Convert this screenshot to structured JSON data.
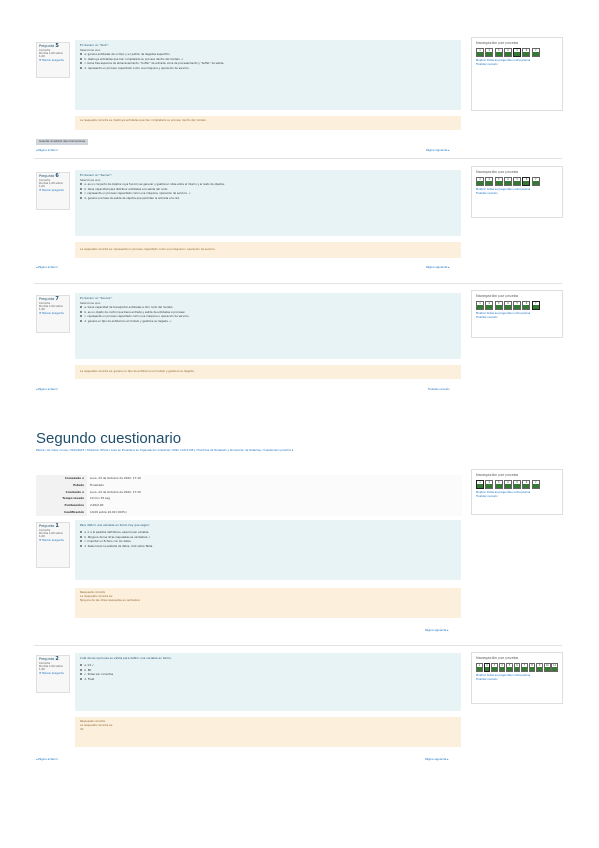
{
  "block1": {
    "info": {
      "label": "Pregunta",
      "num": "5",
      "state": "Correcta",
      "mark": "Puntúa 1,00 sobre 1,00",
      "flag": "Marcar pregunta"
    },
    "question": "En Sensor un \"Sink\":",
    "select": "Seleccione una:",
    "options": [
      {
        "letter": "a.",
        "text": "genera entidades de un tipo y un patrón de llegadas específico",
        "checked": false,
        "correct": false
      },
      {
        "letter": "b.",
        "text": "destruye entidades que han completado su proceso dentro del modelo.",
        "checked": true,
        "correct": true
      },
      {
        "letter": "c.",
        "text": "tiene tres espacios de almacenamiento: \"buffer\" de entrada, zona de procesamiento y \"buffer\" de salida.",
        "checked": false,
        "correct": false
      },
      {
        "letter": "d.",
        "text": "representa un proceso capacitado como una máquina y operación de servicio.",
        "checked": false,
        "correct": false
      }
    ],
    "feedback": "La respuesta correcta es: destruye entidades que han completado su proceso dentro del modelo.",
    "button": "Guardar el estado das marcaciones",
    "prev": "◂ Página anterior",
    "next": "Página siguiente ▸",
    "nav": {
      "title": "Navegación por prueba",
      "cells": [
        "1",
        "2",
        "3",
        "4",
        "5",
        "6",
        "7"
      ],
      "current": 4,
      "link1": "Mostrar todas as preguntas nunha páxina",
      "link2": "Finalizar revisión"
    }
  },
  "block2": {
    "info": {
      "label": "Pregunta",
      "num": "6",
      "state": "Correcta",
      "mark": "Puntúa 1,00 sobre 1,00",
      "flag": "Marcar pregunta"
    },
    "question": "En Sensor un \"Server\":",
    "select": "Seleccione una:",
    "options": [
      {
        "letter": "a.",
        "text": "es un conjunto de objetos cuya función es generar y gestionar rutas entre el mismo y el resto de objetos.",
        "checked": false,
        "correct": false
      },
      {
        "letter": "b.",
        "text": "tiene capacidad para distribuir entidades a la salida del nodo.",
        "checked": false,
        "correct": false
      },
      {
        "letter": "c.",
        "text": "representa un proceso capacitado como una máquina, operación de servicio.",
        "checked": true,
        "correct": true
      },
      {
        "letter": "d.",
        "text": "genera una tasa de salida de objetos que permiten la entrada a la red.",
        "checked": false,
        "correct": false
      }
    ],
    "feedback": "La respuesta correcta es: representa un proceso capacitado como una máquina u operación de servicio.",
    "prev": "◂ Página anterior",
    "next": "Página siguiente ▸",
    "nav": {
      "title": "Navegación por prueba",
      "cells": [
        "1",
        "2",
        "3",
        "4",
        "5",
        "6",
        "7"
      ],
      "current": 5,
      "link1": "Mostrar todas as preguntas nunha páxina",
      "link2": "Finalizar revisión"
    }
  },
  "block3": {
    "info": {
      "label": "Pregunta",
      "num": "7",
      "state": "Correcta",
      "mark": "Puntúa 1,00 sobre 1,00",
      "flag": "Marcar pregunta"
    },
    "question": "En Sensor un \"Source\":",
    "select": "Seleccione una:",
    "options": [
      {
        "letter": "a.",
        "text": "tiene capacidad de transportar entidades a otro nodo del modelo.",
        "checked": false,
        "correct": false
      },
      {
        "letter": "b.",
        "text": "es un objeto de control que tiene entrada y salida de entidades a procesar.",
        "checked": false,
        "correct": false
      },
      {
        "letter": "c.",
        "text": "representa un proceso capacitado como una máquina u operación de servicio.",
        "checked": false,
        "correct": false
      },
      {
        "letter": "d.",
        "text": "genera un tipo de entidad en el modelo y gestiona su llegada.",
        "checked": true,
        "correct": true
      }
    ],
    "feedback": "La respuesta correcta es: genera un tipo de entidad en el modelo y gestiona su llegada.",
    "prev": "◂ Página anterior",
    "next": "Finalizar revisión",
    "nav": {
      "title": "Navegación por prueba",
      "cells": [
        "1",
        "2",
        "3",
        "4",
        "5",
        "6",
        "7"
      ],
      "current": 6,
      "link1": "Mostrar todas as preguntas nunha páxina",
      "link2": "Finalizar revisión"
    }
  },
  "page2": {
    "title": "Segundo cuestionario",
    "breadcrumb": "Páxina / Os meus cursos / 2022/2023 / Titulación Oficial / Grao en Enxeñaría en Organización Industrial / 2022 / G2111451 / Prácticas de Modelado y Simulación de Sistemas / Cuestionario práctica 4",
    "summary": [
      {
        "k": "Comezado o",
        "v": "Luns, 24 de Outubro de 2022, 17:10"
      },
      {
        "k": "Estado",
        "v": "Finalizado"
      },
      {
        "k": "Concluído o",
        "v": "Luns, 24 de Outubro de 2022, 17:20"
      },
      {
        "k": "Tempo levado",
        "v": "10 min 35 seg"
      },
      {
        "k": "Puntuacións",
        "v": "2,00/2,00"
      },
      {
        "k": "Cualificación",
        "v": "10,00 sobre 10,00 (100%)"
      }
    ],
    "q1": {
      "info": {
        "label": "Pregunta",
        "num": "1",
        "state": "Correcta",
        "mark": "Puntúa 1,00 sobre 1,00",
        "flag": "Marcar pregunta"
      },
      "question": "Para definir una variable en Simio hay que seguir:",
      "options": [
        {
          "letter": "a.",
          "text": "Ir a la pestaña definitions, seleccionar variable.",
          "checked": false,
          "correct": false
        },
        {
          "letter": "b.",
          "text": "Ninguna de las otras respuestas es verdadera",
          "checked": true,
          "correct": true
        },
        {
          "letter": "c.",
          "text": "Importar un fichero con los datos.",
          "checked": false,
          "correct": false
        },
        {
          "letter": "d.",
          "text": "Seleccionar la pestaña de datos, click sobre Tabla.",
          "checked": false,
          "correct": false
        }
      ],
      "fb_title": "Respuesta correcta",
      "fb_line1": "La respuesta correcta es:",
      "fb_line2": "Ninguna de las otras respuestas es verdadera",
      "next": "Página siguiente ▸"
    },
    "q2": {
      "info": {
        "label": "Pregunta",
        "num": "2",
        "state": "Correcta",
        "mark": "Puntúa 1,00 sobre 1,00",
        "flag": "Marcar pregunta"
      },
      "question": "Cuál de las opciones es válida para definir una variable en Simio:",
      "options": [
        {
          "letter": "a.",
          "text": "Int",
          "checked": true,
          "correct": true
        },
        {
          "letter": "b.",
          "text": "Bit",
          "checked": false,
          "correct": false
        },
        {
          "letter": "c.",
          "text": "Todas son correctas",
          "checked": false,
          "correct": false
        },
        {
          "letter": "d.",
          "text": "Float",
          "checked": false,
          "correct": false
        }
      ],
      "fb_title": "Respuesta correcta",
      "fb_line1": "La respuesta correcta es:",
      "fb_line2": "Int",
      "prev": "◂ Página anterior",
      "next": "Página siguiente ▸"
    },
    "nav1": {
      "title": "Navegación por prueba",
      "cells": [
        "1",
        "2",
        "3",
        "4",
        "5",
        "6",
        "7"
      ],
      "current": 0,
      "link1": "Mostrar todas as preguntas nunha páxina",
      "link2": "Finalizar revisión"
    },
    "nav2": {
      "title": "Navegación por prueba",
      "cells": [
        "1",
        "2",
        "3",
        "4",
        "5",
        "6",
        "7",
        "8",
        "9",
        "10",
        "11"
      ],
      "current": 1,
      "link1": "Mostrar todas as preguntas nunha páxina",
      "link2": "Finalizar revisión"
    }
  },
  "colors": {
    "question_bg": "#e7f3f5",
    "feedback_bg": "#fcefdc",
    "correct_green": "#357a32",
    "link_blue": "#0f6cbf"
  }
}
